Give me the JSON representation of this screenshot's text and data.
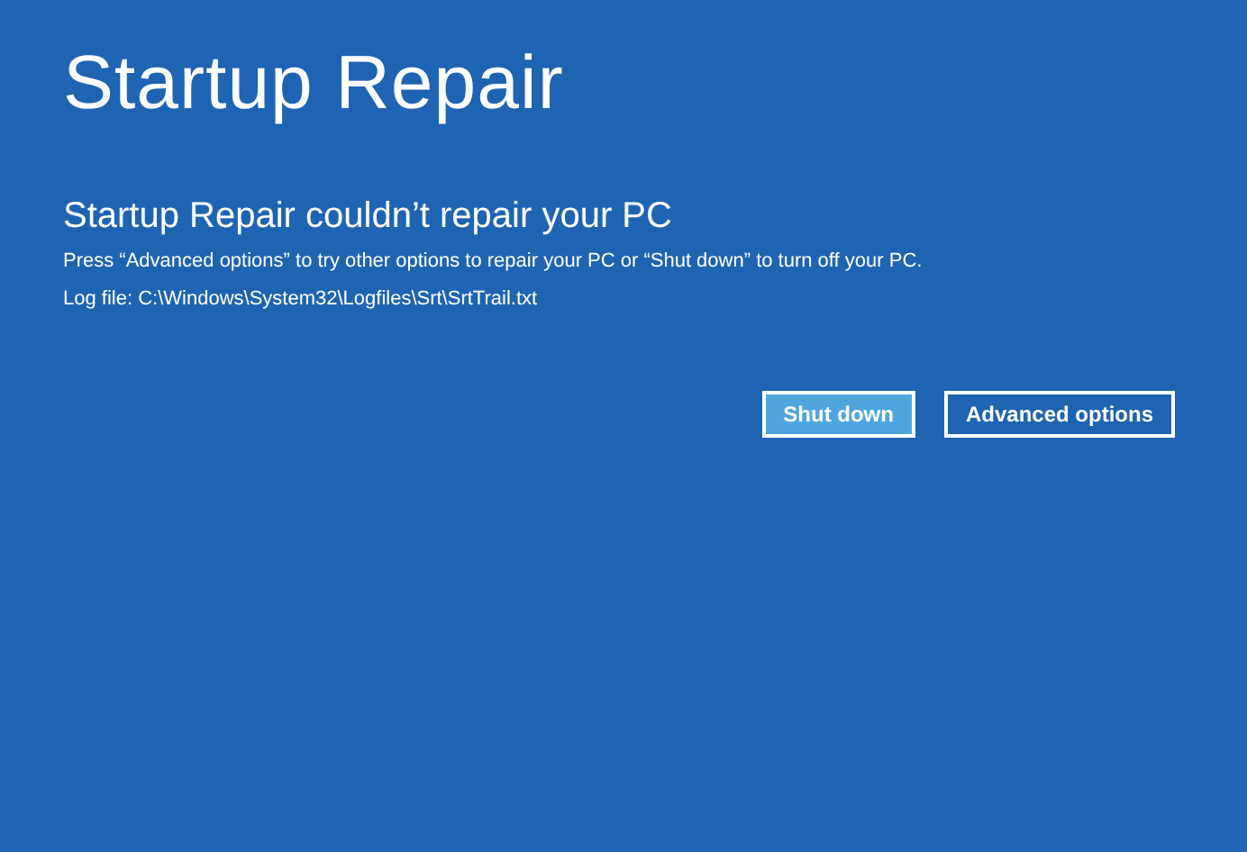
{
  "title": "Startup Repair",
  "heading": "Startup Repair couldn’t repair your PC",
  "message": "Press “Advanced options” to try other options to repair your PC or “Shut down” to turn off your PC.",
  "log_file": "Log file: C:\\Windows\\System32\\Logfiles\\Srt\\SrtTrail.txt",
  "buttons": [
    {
      "label": "Shut down",
      "selected": true
    },
    {
      "label": "Advanced options",
      "selected": false
    }
  ]
}
